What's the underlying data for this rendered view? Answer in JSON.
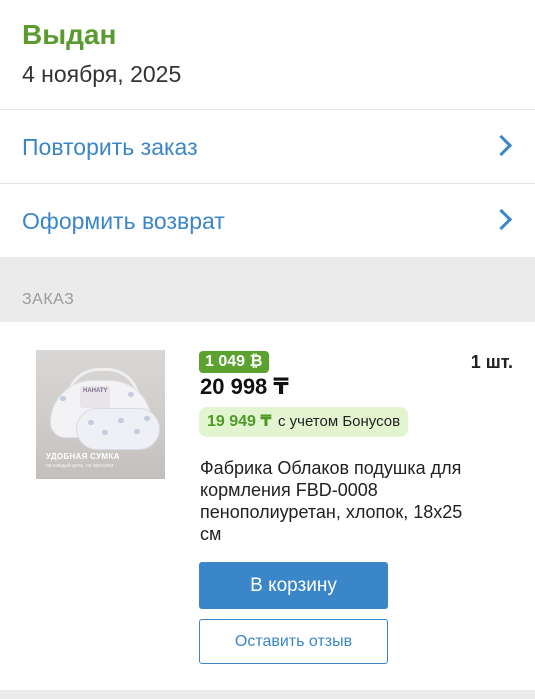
{
  "order_status": {
    "title": "Выдан",
    "date": "4 ноября, 2025"
  },
  "actions": [
    {
      "label": "Повторить заказ",
      "icon": "chevron-right-icon"
    },
    {
      "label": "Оформить возврат",
      "icon": "chevron-right-icon"
    }
  ],
  "section": {
    "label": "ЗАКАЗ"
  },
  "item": {
    "image_caption": "УДОБНАЯ СУМКА",
    "image_subcaption": "на каждый день, на прогулки",
    "image_logo": "HAHATY",
    "bonus_badge": "1 049 ₿",
    "price": "20 998 ₸",
    "quantity": "1 шт.",
    "bonus_price_value": "19 949 ₸",
    "bonus_price_text": "с учетом Бонусов",
    "title": "Фабрика Облаков подушка для кормления FBD-0008 пенополиуретан, хлопок, 18x25 см",
    "add_to_cart_label": "В корзину",
    "review_label": "Оставить отзыв"
  },
  "colors": {
    "status_green": "#5a9a2e",
    "link_blue": "#3a86c8",
    "bonus_green": "#5ba32e",
    "bonus_bg": "#e3f4d1",
    "section_bg": "#ebebeb"
  }
}
